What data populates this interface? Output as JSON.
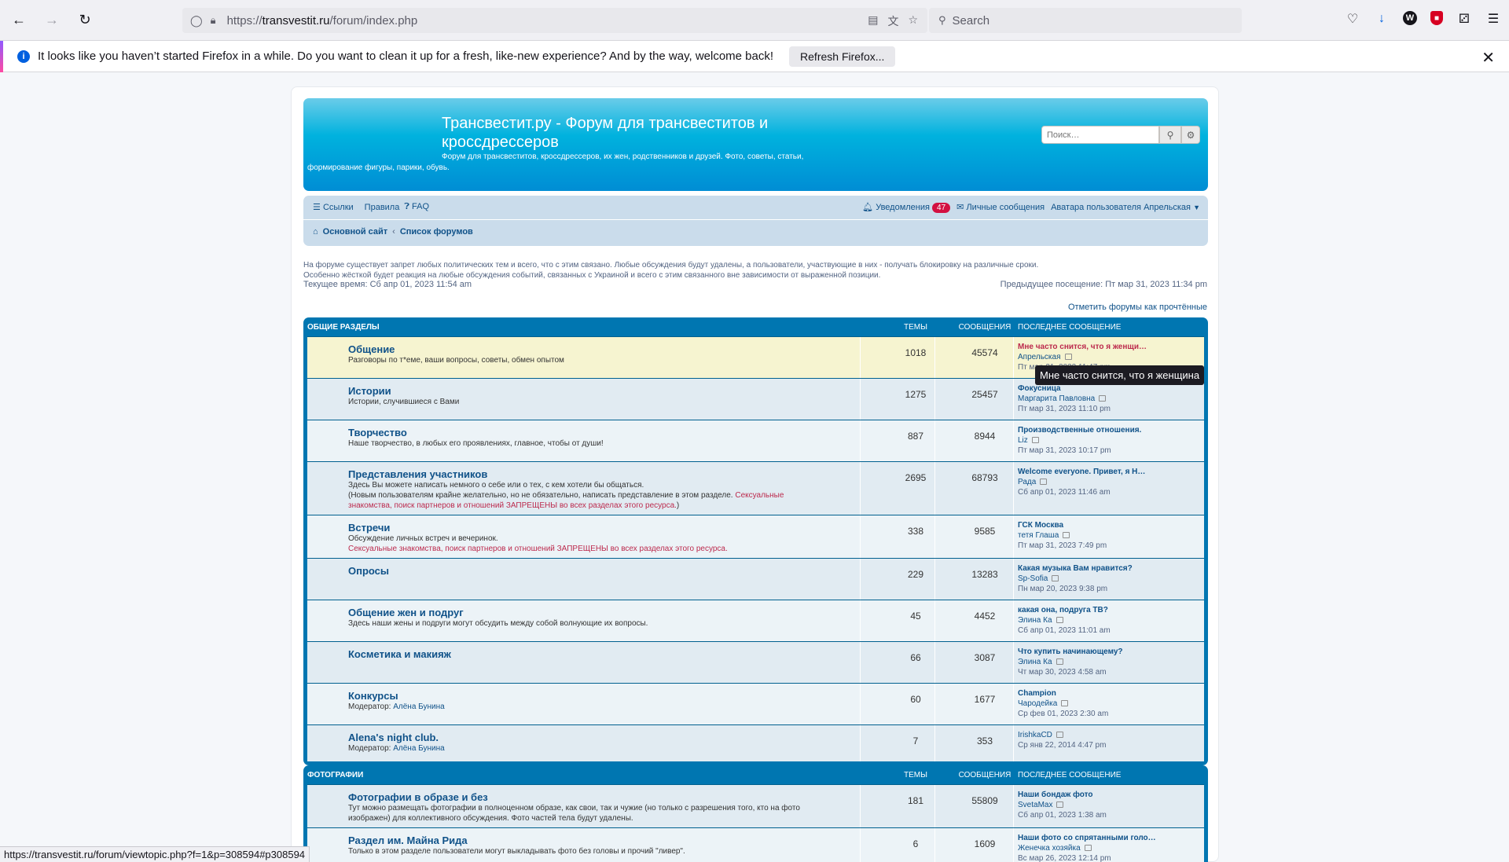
{
  "browser": {
    "url_prefix": "https://",
    "url_host": "transvestit.ru",
    "url_path": "/forum/index.php",
    "search_placeholder": "Search"
  },
  "notification": {
    "text": "It looks like you haven’t started Firefox in a while. Do you want to clean it up for a fresh, like-new experience? And by the way, welcome back!",
    "button": "Refresh Firefox..."
  },
  "header": {
    "title": "Трансвестит.ру - Форум для трансвеститов и кроссдрессеров",
    "description": "Форум для трансвеститов, кроссдрессеров, их жен, родственников и друзей. Фото, советы, статьи, формирование фигуры, парики, обувь.",
    "search_placeholder": "Поиск…"
  },
  "nav": {
    "links": "Ссылки",
    "rules": "Правила",
    "faq": "FAQ",
    "notifications": "Уведомления",
    "notifications_count": "47",
    "messages": "Личные сообщения",
    "user": "Аватара пользователя Апрельская",
    "crumb_home": "Основной сайт",
    "crumb_index": "Список форумов"
  },
  "announce": {
    "line1": "На форуме существует запрет любых политических тем и всего, что с этим связано. Любые обсуждения будут удалены, а пользователи, участвующие в них - получать блокировку на различные сроки.",
    "line2": "Особенно жёсткой будет реакция на любые обсуждения событий, связанных с Украиной и всего с этим связанного вне зависимости от выраженной позиции.",
    "current_time": "Текущее время: Сб апр 01, 2023 11:54 am",
    "last_visit": "Предыдущее посещение: Пт мар 31, 2023 11:34 pm",
    "mark_read": "Отметить форумы как прочтённые"
  },
  "columns": {
    "topics": "Темы",
    "posts": "Сообщения",
    "last_post": "Последнее сообщение"
  },
  "section1": {
    "title": "Общие разделы",
    "forums": [
      {
        "title": "Общение",
        "desc": "Разговоры по т*еме, ваши вопросы, советы, обмен опытом",
        "topics": "1018",
        "posts": "45574",
        "lp_title": "Мне часто снится, что я женщи…",
        "lp_author": "Апрельская",
        "lp_time": "Пт мар 31, 2023 11:47 pm"
      },
      {
        "title": "Истории",
        "desc": "Истории, случившиеся с Вами",
        "topics": "1275",
        "posts": "25457",
        "lp_title": "Фокусница",
        "lp_author": "Маргарита Павловна",
        "lp_time": "Пт мар 31, 2023 11:10 pm"
      },
      {
        "title": "Творчество",
        "desc": "Наше творчество, в любых его проявлениях, главное, чтобы от души!",
        "topics": "887",
        "posts": "8944",
        "lp_title": "Производственные отношения.",
        "lp_author": "Liz",
        "lp_time": "Пт мар 31, 2023 10:17 pm"
      },
      {
        "title": "Представления участников",
        "desc": "Здесь Вы можете написать немного о себе или о тех, с кем хотели бы общаться.",
        "desc2": "(Новым пользователям крайне желательно, но не обязательно, написать представление в этом разделе. ",
        "desc_red": "Сексуальные знакомства, поиск партнеров и отношений ЗАПРЕЩЕНЫ во всех разделах этого ресурса.",
        "desc_end": ")",
        "topics": "2695",
        "posts": "68793",
        "lp_title": "Welcome everyone. Привет, я Н…",
        "lp_author": "Рада",
        "lp_time": "Сб апр 01, 2023 11:46 am"
      },
      {
        "title": "Встречи",
        "desc": "Обсуждение личных встреч и вечеринок.",
        "desc_red": "Сексуальные знакомства, поиск партнеров и отношений ЗАПРЕЩЕНЫ во всех разделах этого ресурса.",
        "topics": "338",
        "posts": "9585",
        "lp_title": "ГСК Москва",
        "lp_author": "тетя Глаша",
        "lp_time": "Пт мар 31, 2023 7:49 pm"
      },
      {
        "title": "Опросы",
        "desc": "",
        "topics": "229",
        "posts": "13283",
        "lp_title": "Какая музыка Вам нравится?",
        "lp_author": "Sp-Sofia",
        "lp_time": "Пн мар 20, 2023 9:38 pm"
      },
      {
        "title": "Общение жен и подруг",
        "desc": "Здесь наши жены и подруги могут обсудить между собой волнующие их вопросы.",
        "topics": "45",
        "posts": "4452",
        "lp_title": "какая она, подруга ТВ?",
        "lp_author": "Элина Ка",
        "lp_time": "Сб апр 01, 2023 11:01 am"
      },
      {
        "title": "Косметика и макияж",
        "desc": "",
        "topics": "66",
        "posts": "3087",
        "lp_title": "Что купить начинающему?",
        "lp_author": "Элина Ка",
        "lp_time": "Чт мар 30, 2023 4:58 am"
      },
      {
        "title": "Конкурсы",
        "mod_label": "Модератор:",
        "mod_name": "Алёна Бунина",
        "topics": "60",
        "posts": "1677",
        "lp_title": "Champion",
        "lp_author": "Чародейка",
        "lp_time": "Ср фев 01, 2023 2:30 am"
      },
      {
        "title": "Alena's night club.",
        "mod_label": "Модератор:",
        "mod_name": "Алёна Бунина",
        "topics": "7",
        "posts": "353",
        "lp_title": "",
        "lp_author": "IrishkaCD",
        "lp_time": "Ср янв 22, 2014 4:47 pm"
      }
    ]
  },
  "section2": {
    "title": "Фотографии",
    "forums": [
      {
        "title": "Фотографии в образе и без",
        "desc": "Тут можно размещать фотографии в полноценном образе, как свои, так и чужие (но только с разрешения того, кто на фото изображен) для коллективного обсуждения. Фото частей тела будут удалены.",
        "topics": "181",
        "posts": "55809",
        "lp_title": "Наши бондаж фото",
        "lp_author": "SvetaMax",
        "lp_time": "Сб апр 01, 2023 1:38 am"
      },
      {
        "title": "Раздел им. Майна Рида",
        "desc": "Только в этом разделе пользователи могут выкладывать фото без головы и прочий \"ливер\".",
        "topics": "6",
        "posts": "1609",
        "lp_title": "Наши фото со спрятанными голо…",
        "lp_author": "Женечка хозяйка",
        "lp_time": "Вс мар 26, 2023 12:14 pm"
      }
    ]
  },
  "tooltip": "Мне часто снится, что я женщина",
  "statusbar": "https://transvestit.ru/forum/viewtopic.php?f=1&p=308594#p308594"
}
